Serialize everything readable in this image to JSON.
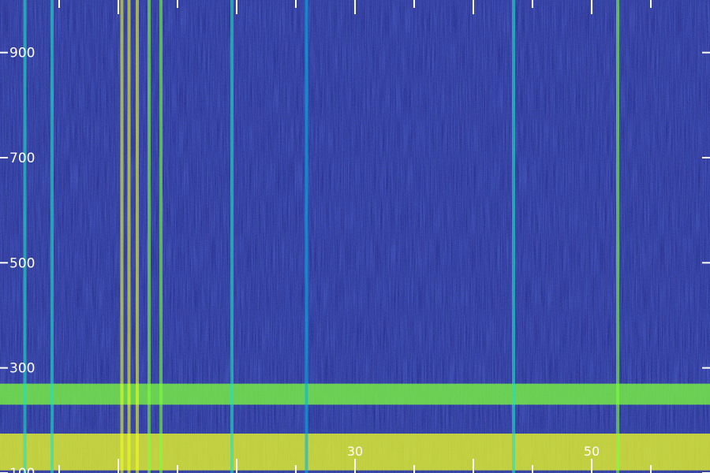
{
  "chart_data": {
    "type": "heatmap",
    "title": "",
    "xlabel": "",
    "ylabel": "",
    "y_ticks": [
      {
        "value": 100,
        "label": "100"
      },
      {
        "value": 300,
        "label": "300"
      },
      {
        "value": 500,
        "label": "500"
      },
      {
        "value": 700,
        "label": "700"
      },
      {
        "value": 900,
        "label": "900"
      }
    ],
    "x_ticks": [
      {
        "value": 30,
        "label": "30"
      },
      {
        "value": 50,
        "label": "50"
      }
    ],
    "ylim": [
      100,
      1000
    ],
    "xlim": [
      0,
      60
    ],
    "colormap": [
      "#1a1a6e",
      "#1f3fd8",
      "#00b4e6",
      "#22e0c0",
      "#7cff3a",
      "#f0ff20",
      "#ff3a10"
    ],
    "background_color": "#1a1a6e",
    "grid": false,
    "bands": [
      {
        "y_from": 230,
        "y_to": 270,
        "intensity": 0.62
      },
      {
        "y_from": 105,
        "y_to": 175,
        "intensity": 0.75
      }
    ],
    "vertical_lines": [
      {
        "x": 2.1,
        "intensity": 0.55
      },
      {
        "x": 4.4,
        "intensity": 0.45
      },
      {
        "x": 10.3,
        "intensity": 0.8
      },
      {
        "x": 10.9,
        "intensity": 0.85
      },
      {
        "x": 11.6,
        "intensity": 0.75
      },
      {
        "x": 12.6,
        "intensity": 0.65
      },
      {
        "x": 13.6,
        "intensity": 0.7
      },
      {
        "x": 19.6,
        "intensity": 0.45
      },
      {
        "x": 25.9,
        "intensity": 0.35
      },
      {
        "x": 43.4,
        "intensity": 0.55
      },
      {
        "x": 52.2,
        "intensity": 0.6
      }
    ]
  }
}
